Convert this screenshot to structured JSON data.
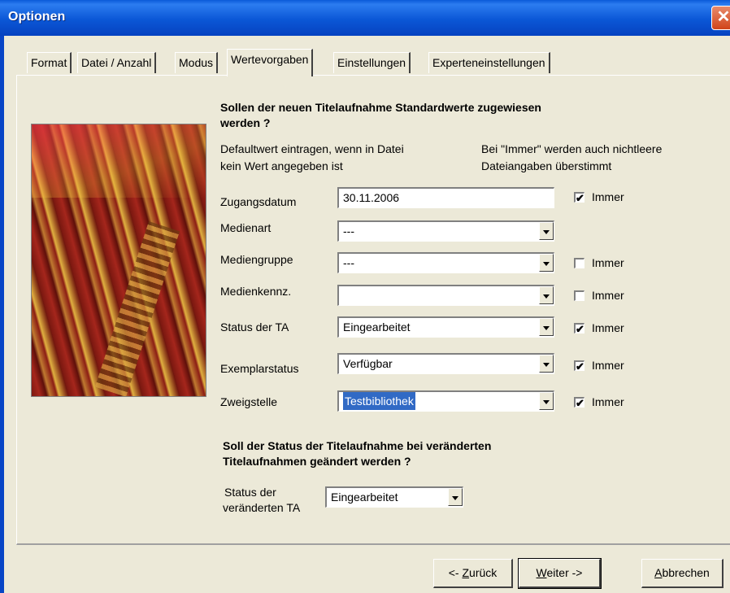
{
  "window": {
    "title": "Optionen",
    "close_glyph": "✕"
  },
  "tabs": [
    {
      "label": "Format"
    },
    {
      "label": "Datei / Anzahl"
    },
    {
      "label": "Modus"
    },
    {
      "label": "Wertevorgaben",
      "active": true
    },
    {
      "label": "Einstellungen"
    },
    {
      "label": "Experteneinstellungen"
    }
  ],
  "panel": {
    "heading1_line1": "Sollen der neuen Titelaufnahme Standardwerte zugewiesen",
    "heading1_line2": "werden ?",
    "hint_left_line1": "Defaultwert eintragen, wenn in Datei",
    "hint_left_line2": "kein Wert angegeben ist",
    "hint_right_line1": "Bei \"Immer\" werden auch nichtleere",
    "hint_right_line2": "Dateiangaben überstimmt",
    "rows": [
      {
        "label": "Zugangsdatum",
        "value": "30.11.2006",
        "type": "text",
        "immer_label": "Immer",
        "immer_checked": true,
        "immer_mark": "✔"
      },
      {
        "label": "Medienart",
        "value": "---",
        "type": "select"
      },
      {
        "label": "Mediengruppe",
        "value": "---",
        "type": "select",
        "immer_label": "Immer",
        "immer_checked": false,
        "immer_mark": ""
      },
      {
        "label": "Medienkennz.",
        "value": "",
        "type": "select",
        "immer_label": "Immer",
        "immer_checked": false,
        "immer_mark": ""
      },
      {
        "label": "Status der TA",
        "value": "Eingearbeitet",
        "type": "select",
        "immer_label": "Immer",
        "immer_checked": true,
        "immer_mark": "✔"
      },
      {
        "label": "Exemplarstatus",
        "value": "Verfügbar",
        "type": "select",
        "immer_label": "Immer",
        "immer_checked": true,
        "immer_mark": "✔"
      },
      {
        "label": "Zweigstelle",
        "value": "Testbibliothek",
        "type": "select",
        "selected": true,
        "immer_label": "Immer",
        "immer_checked": true,
        "immer_mark": "✔"
      }
    ],
    "heading2_line1": "Soll der Status der Titelaufnahme bei veränderten",
    "heading2_line2": "Titelaufnahmen geändert werden ?",
    "changed_label_line1": "Status der",
    "changed_label_line2": "veränderten TA",
    "changed_value": "Eingearbeitet"
  },
  "buttons": {
    "back_prefix": "<- ",
    "back_u": "Z",
    "back_rest": "urück",
    "next_u": "W",
    "next_rest": "eiter ->",
    "cancel_u": "A",
    "cancel_rest": "bbrechen"
  },
  "colors": {
    "titlebar": "#0a5ad8",
    "dialog": "#ece9d8",
    "selection": "#316ac5"
  }
}
